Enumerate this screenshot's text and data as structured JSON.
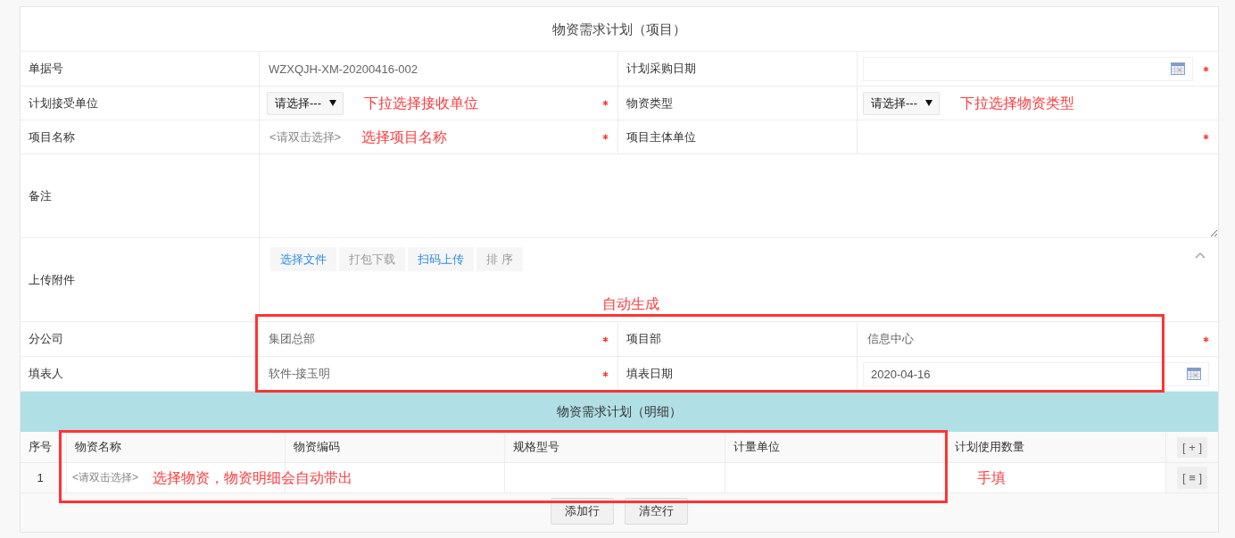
{
  "title": "物资需求计划（项目）",
  "form": {
    "rows": [
      {
        "kind": "pair",
        "left": {
          "label": "单据号",
          "kind": "text",
          "value": "WZXQJH-XM-20200416-002",
          "required": false
        },
        "right": {
          "label": "计划采购日期",
          "kind": "date",
          "required": true
        }
      },
      {
        "kind": "pair",
        "left": {
          "label": "计划接受单位",
          "kind": "select",
          "value": "请选择---",
          "note": "下拉选择接收单位",
          "required": true
        },
        "right": {
          "label": "物资类型",
          "kind": "select",
          "value": "请选择---",
          "note": "下拉选择物资类型",
          "required": false
        }
      },
      {
        "kind": "pair",
        "left": {
          "label": "项目名称",
          "kind": "picker",
          "placeholder": "<请双击选择>",
          "note": "选择项目名称",
          "required": true
        },
        "right": {
          "label": "项目主体单位",
          "kind": "text",
          "required": true
        }
      },
      {
        "kind": "textarea",
        "label": "备注"
      },
      {
        "kind": "attachments",
        "label": "上传附件",
        "expanded": true,
        "buttons": [
          {
            "label": "选择文件",
            "disabled": false
          },
          {
            "label": "打包下载",
            "disabled": true
          },
          {
            "label": "扫码上传",
            "disabled": false
          },
          {
            "label": "排 序",
            "disabled": true
          }
        ]
      }
    ],
    "auto_group": {
      "note": "自动生成",
      "rows": [
        {
          "kind": "pair",
          "left": {
            "label": "分公司",
            "kind": "text",
            "value": "集团总部",
            "required": true
          },
          "right": {
            "label": "项目部",
            "kind": "text",
            "value": "信息中心",
            "required": true
          }
        },
        {
          "kind": "pair",
          "left": {
            "label": "填表人",
            "kind": "text",
            "value": "软件-接玉明",
            "required": true
          },
          "right": {
            "label": "填表日期",
            "kind": "date",
            "value": "2020-04-16",
            "required": false
          }
        }
      ]
    }
  },
  "detail": {
    "title": "物资需求计划（明细）",
    "framed": true,
    "columns": [
      "序号",
      "物资名称",
      "物资编码",
      "规格型号",
      "计量单位",
      "计划使用数量"
    ],
    "add_button": "[ + ]",
    "rows": [
      {
        "number": "1",
        "material_placeholder": "<请双击选择>",
        "material_note": "选择物资，物资明细会自动带出",
        "quantity_note": "手填",
        "menu_button": "[ ≡ ]"
      }
    ],
    "buttons": [
      "添加行",
      "清空行"
    ]
  }
}
